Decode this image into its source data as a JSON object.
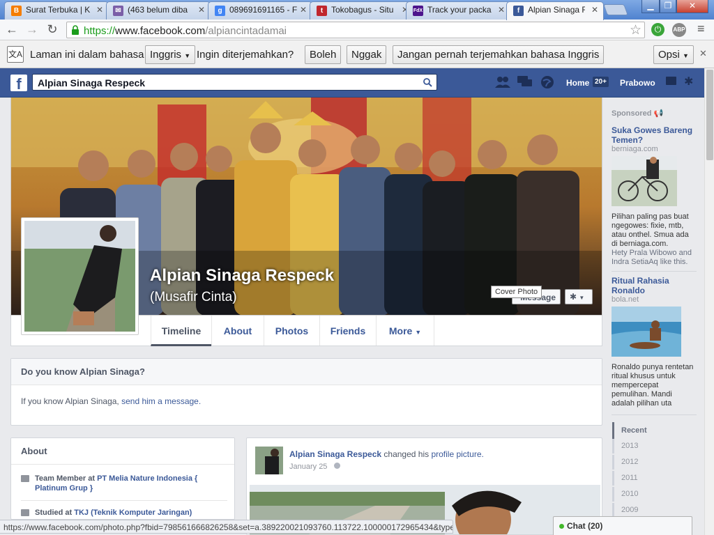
{
  "browser": {
    "tabs": [
      {
        "label": "Surat Terbuka | K",
        "icon": "blogger-icon",
        "color": "#f57d00"
      },
      {
        "label": "(463 belum diba",
        "icon": "mail-icon",
        "color": "#7b5ea7"
      },
      {
        "label": "089691691165 - F",
        "icon": "google-icon",
        "color": "#4285f4"
      },
      {
        "label": "Tokobagus - Situ",
        "icon": "tokobagus-icon",
        "color": "#c0272d"
      },
      {
        "label": "Track your packa",
        "icon": "fedex-icon",
        "color": "#4d148c"
      },
      {
        "label": "Alpian Sinaga Re",
        "icon": "facebook-icon",
        "color": "#3b5998"
      }
    ],
    "url_scheme": "https://",
    "url_host": "www.facebook.com",
    "url_path": "/alpiancintadamai",
    "abp_label": "ABP"
  },
  "translate_bar": {
    "prompt": "Laman ini dalam bahasa",
    "language": "Inggris",
    "question": "Ingin diterjemahkan?",
    "yes": "Boleh",
    "no": "Nggak",
    "never": "Jangan pernah terjemahkan bahasa Inggris",
    "options": "Opsi"
  },
  "fb_header": {
    "logo": "f",
    "search_value": "Alpian Sinaga Respeck",
    "home": "Home",
    "home_count": "20+",
    "user": "Prabowo"
  },
  "profile": {
    "name": "Alpian Sinaga Respeck",
    "nickname": "(Musafir Cinta)",
    "message_button": "Message",
    "cover_tooltip": "Cover Photo",
    "tabs": [
      "Timeline",
      "About",
      "Photos",
      "Friends",
      "More"
    ]
  },
  "know_card": {
    "title": "Do you know Alpian Sinaga?",
    "text_prefix": "If you know Alpian Sinaga,",
    "link": "send him a message."
  },
  "about_card": {
    "title": "About",
    "items": [
      {
        "prefix": "Team Member at",
        "link": "PT Melia Nature Indonesia { Platinum Grup }"
      },
      {
        "prefix": "Studied at",
        "link": "TKJ (Teknik Komputer Jaringan)"
      }
    ]
  },
  "post": {
    "author": "Alpian Sinaga Respeck",
    "action": "changed his",
    "link": "profile picture.",
    "date": "January 25"
  },
  "sidebar": {
    "sponsored": "Sponsored",
    "ads": [
      {
        "title": "Suka Gowes Bareng Temen?",
        "domain": "berniaga.com",
        "text": "Pilihan paling pas buat ngegowes: fixie, mtb, atau onthel. Smua ada di berniaga.com.",
        "social": "Hety Prala Wibowo and Indra SetiaAq like this."
      },
      {
        "title": "Ritual Rahasia Ronaldo",
        "domain": "bola.net",
        "text": "Ronaldo punya rentetan ritual khusus untuk mempercepat pemulihan. Mandi adalah pilihan uta"
      }
    ],
    "years": [
      "Recent",
      "2013",
      "2012",
      "2011",
      "2010",
      "2009"
    ]
  },
  "status_url": "https://www.facebook.com/photo.php?fbid=798561666826258&set=a.389220021093760.113722.100000172965434&type=1",
  "chat": "Chat (20)"
}
